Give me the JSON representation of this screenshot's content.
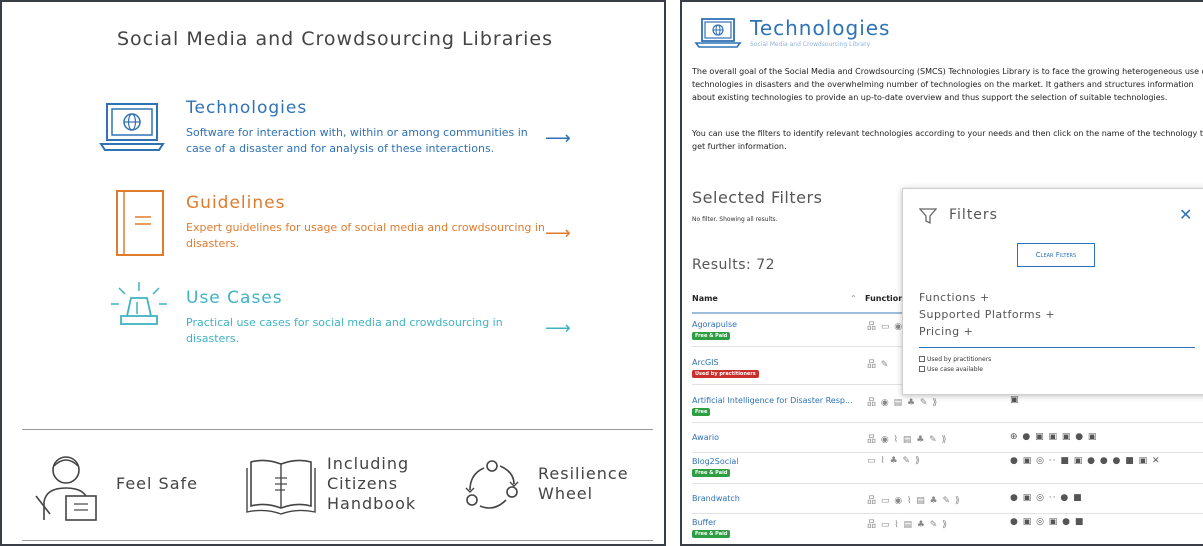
{
  "left": {
    "title": "Social Media and Crowdsourcing Libraries",
    "libraries": [
      {
        "title": "Technologies",
        "desc": "Software for interaction with, within or among communities in case of a disaster and for analysis of these interactions.",
        "icon": "laptop-globe-icon",
        "color": "#2f72b5"
      },
      {
        "title": "Guidelines",
        "desc": "Expert guidelines for usage of social media and crowdsourcing in disasters.",
        "icon": "book-icon",
        "color": "#e07b2c"
      },
      {
        "title": "Use Cases",
        "desc": "Practical use cases for social media and crowdsourcing in disasters.",
        "icon": "siren-icon",
        "color": "#3fb3c2"
      }
    ],
    "arrow": "⟶",
    "bottom": [
      {
        "label": "Feel Safe",
        "icon": "person-reading-icon"
      },
      {
        "label": "Including Citizens Handbook",
        "line1": "Including",
        "line2": "Citizens",
        "line3": "Handbook",
        "icon": "open-book-icon"
      },
      {
        "label": "Resilience Wheel",
        "line1": "Resilience",
        "line2": "Wheel",
        "icon": "cycle-icon"
      }
    ]
  },
  "right": {
    "title": "Technologies",
    "subtitle": "Social Media and Crowdsourcing Library",
    "intro1": "The overall goal of the Social Media and Crowdsourcing (SMCS) Technologies Library is to face the growing heterogeneous use of technologies in disasters and the overwhelming number of technologies on the market. It gathers and structures information about existing technologies to provide an up-to-date overview and thus support the selection of suitable technologies.",
    "intro2": "You can use the filters to identify relevant technologies according to your needs and then click on the name of the technology to get further information.",
    "selected_filters": "Selected Filters",
    "no_filter": "No filter. Showing all results.",
    "results": "Results: 72",
    "columns": {
      "name": "Name",
      "sort": "⌃",
      "functions": "Functions"
    },
    "rows": [
      {
        "name": "Agorapulse",
        "badge": "Free & Paid",
        "badge_color": "green",
        "functions": "品 ▭ ◉",
        "platforms": ""
      },
      {
        "name": "ArcGIS",
        "badge": "Used by practitioners",
        "badge_color": "red",
        "functions": "品 ✎",
        "platforms": ""
      },
      {
        "name": "Artificial Intelligence for Disaster Resp...",
        "badge": "Free",
        "badge_color": "green",
        "functions": "品 ◉ ▤ ♣ ✎ ⟫",
        "platforms": "▣"
      },
      {
        "name": "Awario",
        "badge": "",
        "badge_color": "",
        "functions": "品 ◉ ⌇ ▤ ♣ ✎ ⟫",
        "platforms": "⊕ ● ▣ ▣ ▣ ● ▣"
      },
      {
        "name": "Blog2Social",
        "badge": "Free & Paid",
        "badge_color": "green",
        "functions": "▭ ⌇ ♣ ✎ ⟫",
        "platforms": "● ▣ ◎ ·· ■ ▣ ● ● ● ■ ▣ ✕"
      },
      {
        "name": "Brandwatch",
        "badge": "",
        "badge_color": "",
        "functions": "品 ▭ ◉ ⌇ ▤ ♣ ✎ ⟫",
        "platforms": "● ▣ ◎ ·· ● ■"
      },
      {
        "name": "Buffer",
        "badge": "Free & Paid",
        "badge_color": "green",
        "functions": "品 ▭ ⌇ ▤ ♣ ✎ ⟫",
        "platforms": "● ▣ ◎ ▣ ● ■"
      }
    ],
    "filters": {
      "title": "Filters",
      "close": "✕",
      "clear": "Clear Filters",
      "sections": [
        "Functions +",
        "Supported Platforms +",
        "Pricing +"
      ],
      "checks": [
        "Used by practitioners",
        "Use case available"
      ]
    }
  }
}
